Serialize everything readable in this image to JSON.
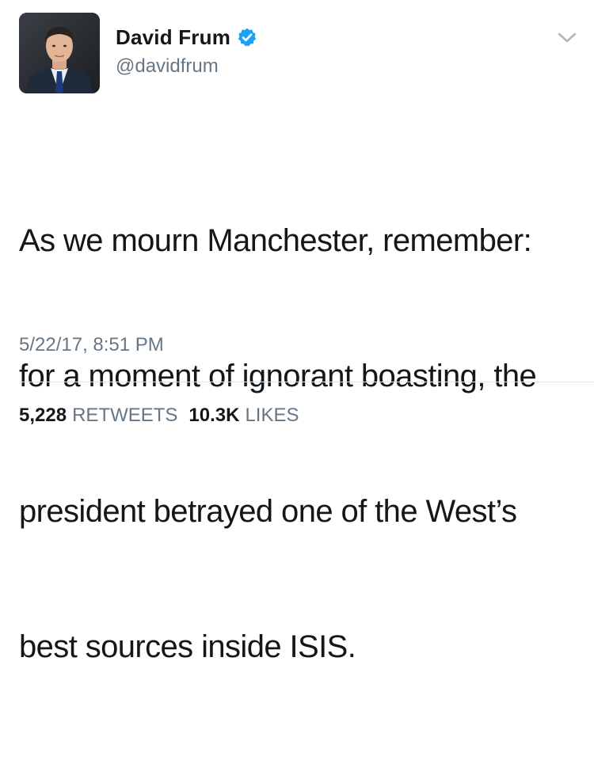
{
  "author": {
    "display_name": "David Frum",
    "handle": "@davidfrum",
    "verified": true
  },
  "icons": {
    "verified": "verified-badge-icon",
    "caret": "chevron-down-icon"
  },
  "tweet": {
    "lines": [
      "As we mourn Manchester, remember:",
      "for a moment of ignorant boasting, the",
      "president betrayed one of the West’s",
      "best sources inside ISIS."
    ],
    "timestamp": "5/22/17, 8:51 PM"
  },
  "stats": {
    "retweets_count": "5,228",
    "retweets_label": "RETWEETS",
    "likes_count": "10.3K",
    "likes_label": "LIKES"
  },
  "colors": {
    "text_primary": "#14171a",
    "text_secondary": "#657786",
    "verified_blue": "#1da1f2",
    "divider": "#e1e8ed"
  }
}
